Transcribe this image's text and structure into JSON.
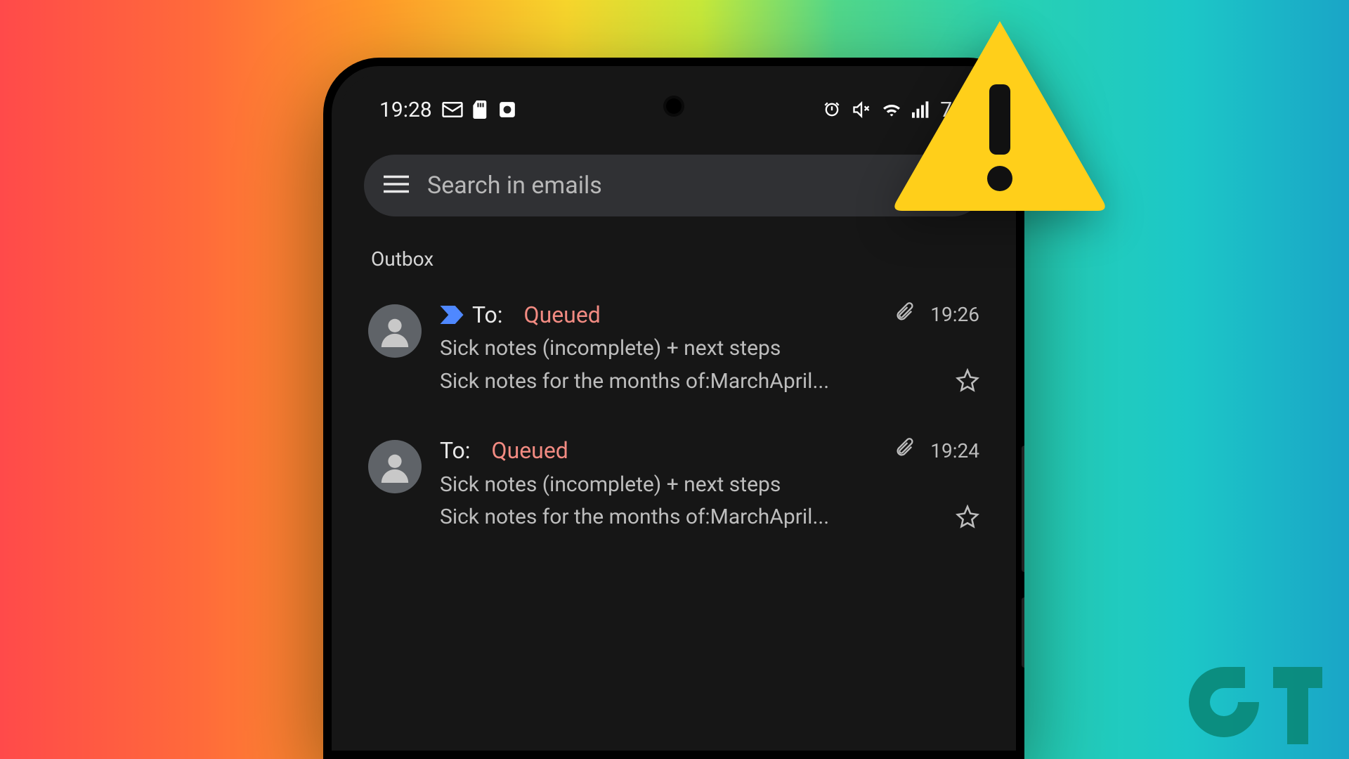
{
  "statusbar": {
    "time": "19:28",
    "battery": "75%"
  },
  "search": {
    "placeholder": "Search in emails"
  },
  "section_label": "Outbox",
  "emails": [
    {
      "to_label": "To:",
      "status": "Queued",
      "time": "19:26",
      "subject": "Sick notes (incomplete) + next steps",
      "preview": "Sick notes for the months of:MarchApril...",
      "important": true,
      "attachment": true
    },
    {
      "to_label": "To:",
      "status": "Queued",
      "time": "19:24",
      "subject": "Sick notes (incomplete) + next steps",
      "preview": "Sick notes for the months of:MarchApril...",
      "important": false,
      "attachment": true
    }
  ]
}
